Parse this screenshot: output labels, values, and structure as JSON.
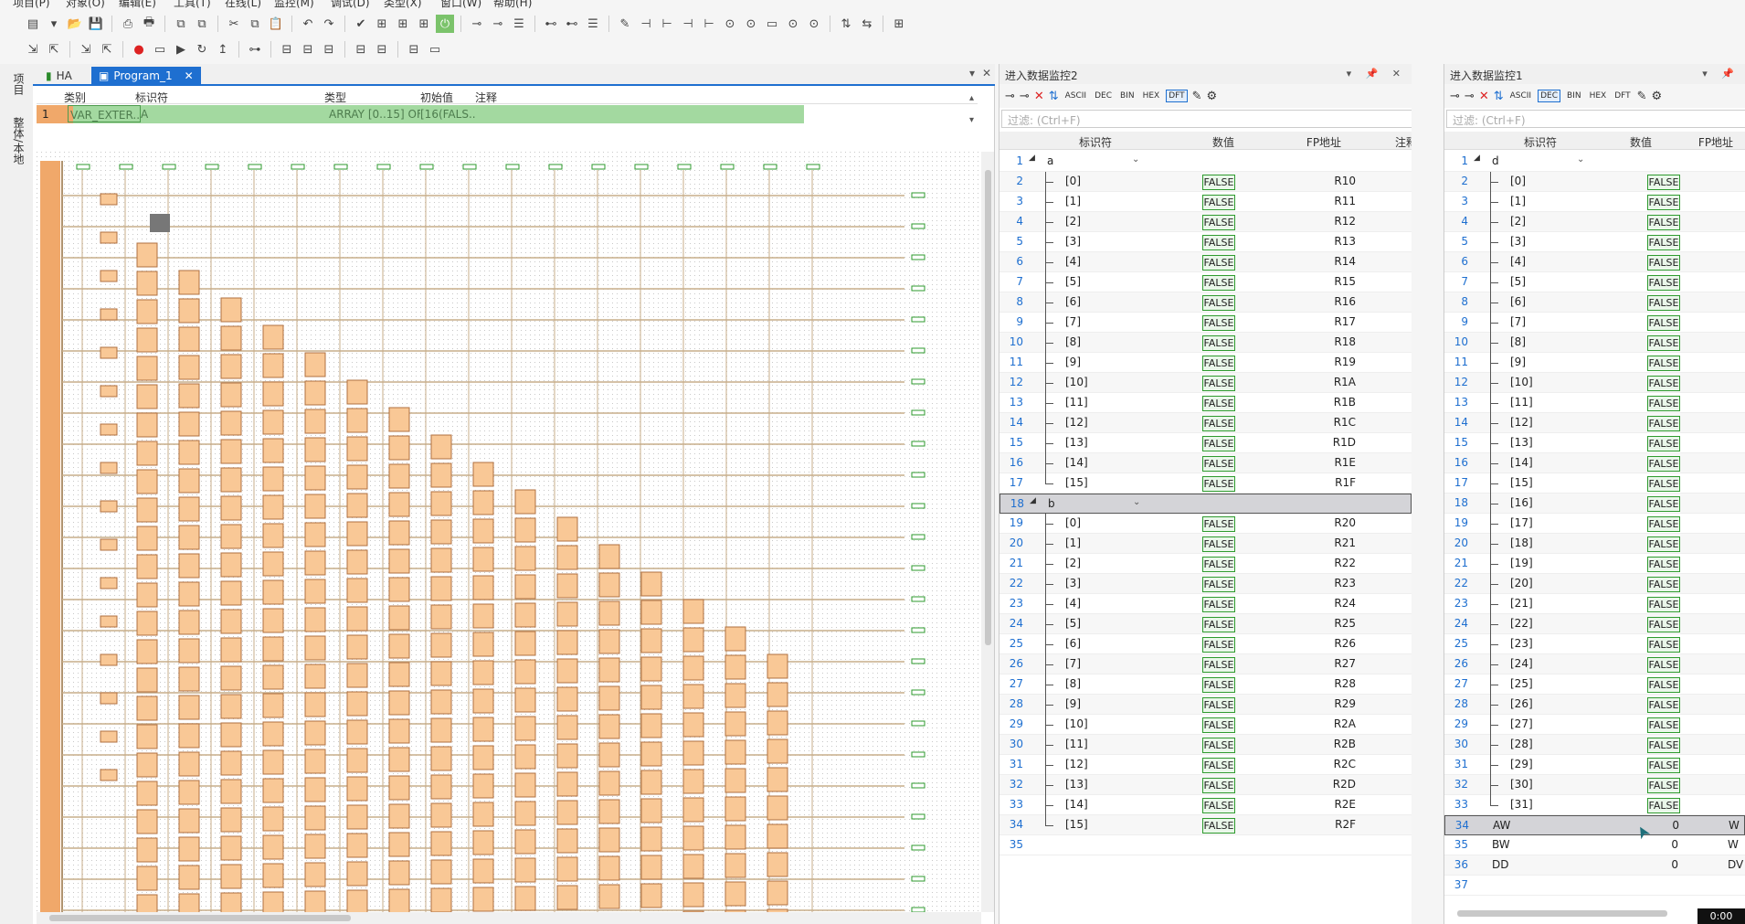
{
  "menu": [
    "项目(P)",
    "对象(O)",
    "编辑(E)",
    "工具(T)",
    "在线(L)",
    "监控(M)",
    "调试(D)",
    "类型(X)",
    "窗口(W)",
    "帮助(H)"
  ],
  "left_tabs": [
    "项目",
    "整体/本地"
  ],
  "editor": {
    "tabs": [
      {
        "label": "HA"
      },
      {
        "label": "Program_1"
      }
    ],
    "var_table": {
      "headers": [
        "类别",
        "标识符",
        "类型",
        "初始值",
        "注释"
      ],
      "row": {
        "num": "1",
        "category": "VAR_EXTER...",
        "identifier": "A",
        "type": "ARRAY [0..15] OF ...",
        "init": "[16(FALS...",
        "comment": ""
      }
    }
  },
  "monitor2": {
    "title": "进入数据监控2",
    "filter_placeholder": "过滤: (Ctrl+F)",
    "headers": [
      "标识符",
      "数值",
      "FP地址",
      "注释"
    ],
    "formats": [
      "ASCII",
      "DEC",
      "BIN",
      "HEX",
      "DFT"
    ],
    "active_format": "DFT",
    "groups": [
      {
        "name": "a",
        "start": 1,
        "addr_prefix": "R1"
      },
      {
        "name": "b",
        "start": 18,
        "addr_prefix": "R2"
      }
    ],
    "value": "FALSE",
    "last_row": "35"
  },
  "monitor1": {
    "title": "进入数据监控1",
    "filter_placeholder": "过滤: (Ctrl+F)",
    "headers": [
      "标识符",
      "数值",
      "FP地址"
    ],
    "formats": [
      "ASCII",
      "DEC",
      "BIN",
      "HEX",
      "DFT"
    ],
    "active_format": "DEC",
    "group": {
      "name": "d",
      "count": 32
    },
    "value": "FALSE",
    "extra_rows": [
      {
        "num": "34",
        "id": "AW",
        "value": "0",
        "fp": "W"
      },
      {
        "num": "35",
        "id": "BW",
        "value": "0",
        "fp": "W"
      },
      {
        "num": "36",
        "id": "DD",
        "value": "0",
        "fp": "DV"
      }
    ],
    "last_row": "37"
  },
  "status_time": "0:00",
  "colors": {
    "accent": "#1e6fd0",
    "value_border": "#2e9a2e",
    "block": "#f9c896",
    "rail": "#f0a86a",
    "var_row": "#a3d9a0"
  }
}
